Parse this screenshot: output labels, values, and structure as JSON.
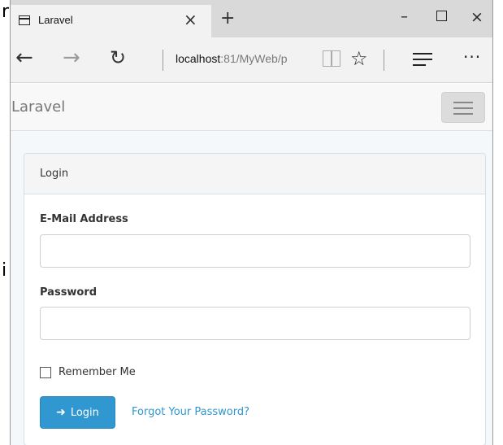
{
  "background_fragments": {
    "top": "r",
    "middle": "i"
  },
  "browser": {
    "tab": {
      "title": "Laravel",
      "close": "×"
    },
    "new_tab": "+",
    "window_controls": {
      "minimize": "–",
      "close": "×"
    },
    "nav": {
      "back": "←",
      "forward": "→",
      "refresh": "↻",
      "star": "☆",
      "more": "···"
    },
    "address": {
      "host": "localhost",
      "path": ":81/MyWeb/p"
    }
  },
  "site": {
    "brand": "Laravel",
    "panel": {
      "heading": "Login",
      "email_label": "E-Mail Address",
      "email_value": "",
      "password_label": "Password",
      "password_value": "",
      "remember_label": "Remember Me",
      "login_button": "Login",
      "login_icon": "sign-in-icon",
      "forgot_link": "Forgot Your Password?"
    }
  },
  "colors": {
    "primary": "#3097d1",
    "panel_border": "#d3e0e9",
    "page_bg": "#f5f8fa"
  }
}
